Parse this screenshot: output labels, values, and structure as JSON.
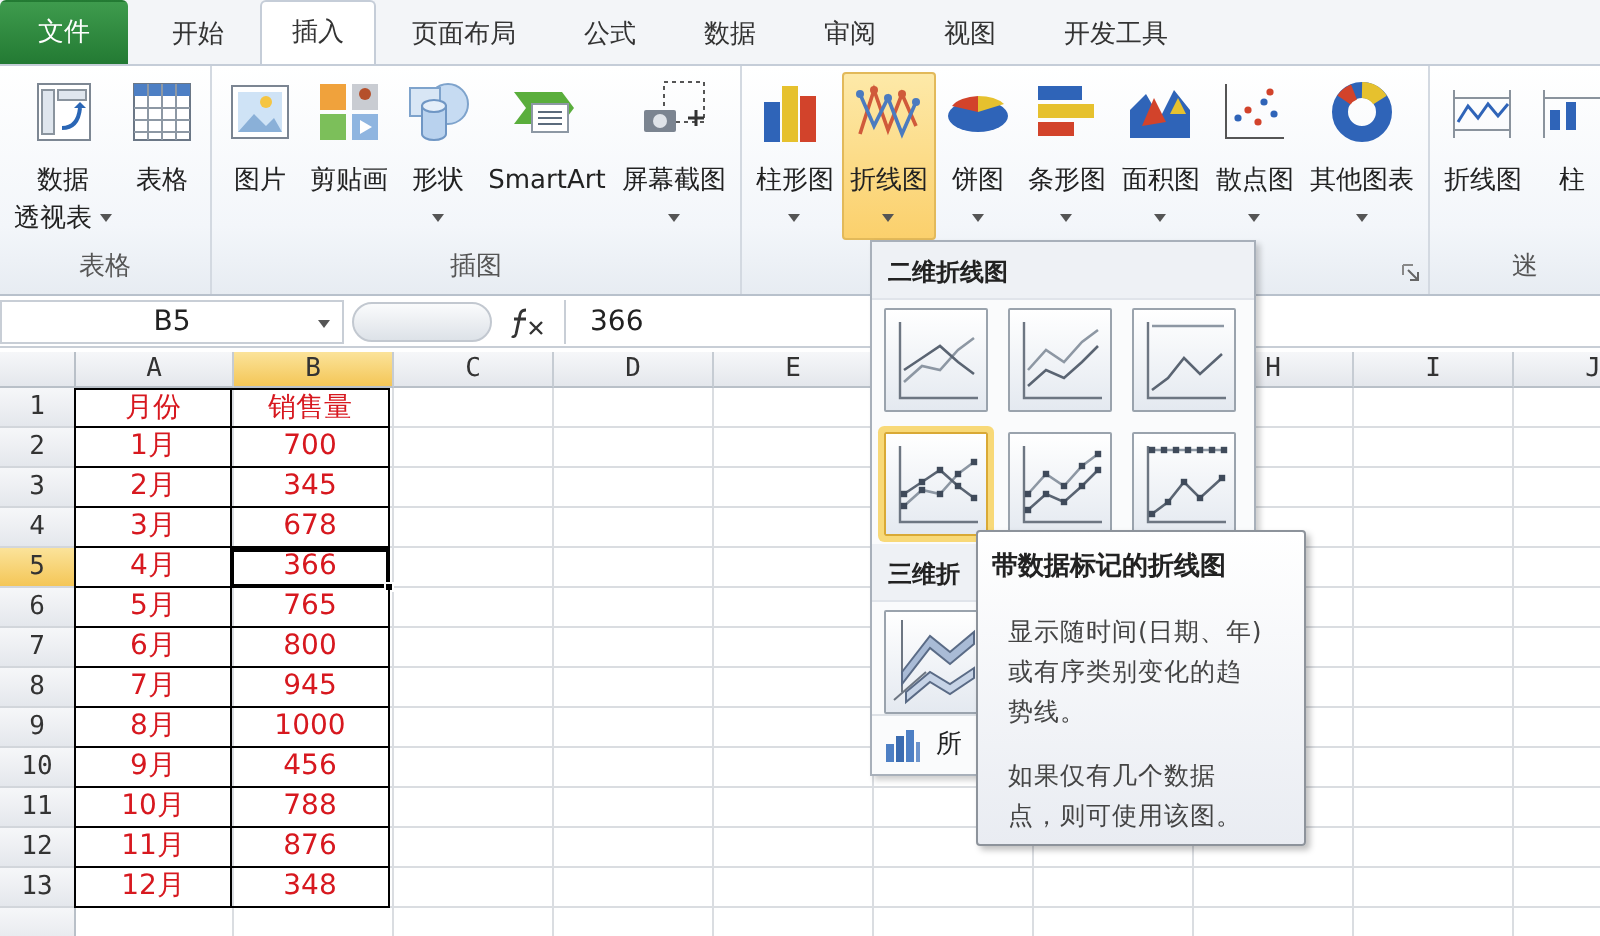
{
  "tabs": [
    {
      "label": "文件",
      "kind": "file",
      "selected": false
    },
    {
      "label": "开始",
      "kind": "tab",
      "selected": false
    },
    {
      "label": "插入",
      "kind": "tab",
      "selected": true
    },
    {
      "label": "页面布局",
      "kind": "tab",
      "selected": false
    },
    {
      "label": "公式",
      "kind": "tab",
      "selected": false
    },
    {
      "label": "数据",
      "kind": "tab",
      "selected": false
    },
    {
      "label": "审阅",
      "kind": "tab",
      "selected": false
    },
    {
      "label": "视图",
      "kind": "tab",
      "selected": false
    },
    {
      "label": "开发工具",
      "kind": "tab",
      "selected": false
    }
  ],
  "ribbon": {
    "groups": [
      {
        "label": "表格",
        "buttons": [
          {
            "kind": "pivot",
            "label": [
              "数据",
              "透视表"
            ],
            "dropdown": true,
            "selected": false
          },
          {
            "kind": "table",
            "label": [
              "表格"
            ],
            "dropdown": false,
            "selected": false
          }
        ]
      },
      {
        "label": "插图",
        "buttons": [
          {
            "kind": "picture",
            "label": [
              "图片"
            ],
            "dropdown": false,
            "selected": false
          },
          {
            "kind": "clipart",
            "label": [
              "剪贴画"
            ],
            "dropdown": false,
            "selected": false
          },
          {
            "kind": "shapes",
            "label": [
              "形状"
            ],
            "dropdown": true,
            "selected": false
          },
          {
            "kind": "smartart",
            "label": [
              "SmartArt"
            ],
            "dropdown": false,
            "selected": false
          },
          {
            "kind": "screenshot",
            "label": [
              "屏幕截图"
            ],
            "dropdown": true,
            "selected": false
          }
        ]
      },
      {
        "launcher": true,
        "buttons": [
          {
            "kind": "column",
            "label": [
              "柱形图"
            ],
            "dropdown": true,
            "selected": false
          },
          {
            "kind": "line",
            "label": [
              "折线图"
            ],
            "dropdown": true,
            "selected": true
          },
          {
            "kind": "pie",
            "label": [
              "饼图"
            ],
            "dropdown": true,
            "selected": false
          },
          {
            "kind": "bar",
            "label": [
              "条形图"
            ],
            "dropdown": true,
            "selected": false
          },
          {
            "kind": "area",
            "label": [
              "面积图"
            ],
            "dropdown": true,
            "selected": false
          },
          {
            "kind": "scatter",
            "label": [
              "散点图"
            ],
            "dropdown": true,
            "selected": false
          },
          {
            "kind": "other",
            "label": [
              "其他图表"
            ],
            "dropdown": true,
            "selected": false
          }
        ]
      },
      {
        "label": "迷",
        "buttons": [
          {
            "kind": "sparkline",
            "label": [
              "折线图"
            ],
            "dropdown": false,
            "selected": false
          },
          {
            "kind": "sparkcolumn",
            "label": [
              "柱"
            ],
            "dropdown": false,
            "selected": false
          }
        ]
      }
    ]
  },
  "formula_bar": {
    "name_box": "B5",
    "formula": "366"
  },
  "sheet": {
    "columns": [
      {
        "kind": "header",
        "label": "A",
        "selected": false
      },
      {
        "kind": "header",
        "label": "B",
        "selected": true
      },
      {
        "kind": "header",
        "label": "C",
        "selected": false
      },
      {
        "kind": "header",
        "label": "D",
        "selected": false
      },
      {
        "kind": "header",
        "label": "E",
        "selected": false
      },
      {
        "kind": "covered"
      },
      {
        "kind": "covered"
      },
      {
        "kind": "header",
        "label": "H",
        "selected": false
      },
      {
        "kind": "header",
        "label": "I",
        "selected": false
      },
      {
        "kind": "header",
        "label": "J",
        "selected": false
      }
    ],
    "rows": [
      {
        "number": "1",
        "selected": false,
        "cells": [
          "月份",
          "销售量"
        ]
      },
      {
        "number": "2",
        "selected": false,
        "cells": [
          "1月",
          "700"
        ]
      },
      {
        "number": "3",
        "selected": false,
        "cells": [
          "2月",
          "345"
        ]
      },
      {
        "number": "4",
        "selected": false,
        "cells": [
          "3月",
          "678"
        ]
      },
      {
        "number": "5",
        "selected": true,
        "cells": [
          "4月",
          "366"
        ]
      },
      {
        "number": "6",
        "selected": false,
        "cells": [
          "5月",
          "765"
        ]
      },
      {
        "number": "7",
        "selected": false,
        "cells": [
          "6月",
          "800"
        ]
      },
      {
        "number": "8",
        "selected": false,
        "cells": [
          "7月",
          "945"
        ]
      },
      {
        "number": "9",
        "selected": false,
        "cells": [
          "8月",
          "1000"
        ]
      },
      {
        "number": "10",
        "selected": false,
        "cells": [
          "9月",
          "456"
        ]
      },
      {
        "number": "11",
        "selected": false,
        "cells": [
          "10月",
          "788"
        ]
      },
      {
        "number": "12",
        "selected": false,
        "cells": [
          "11月",
          "876"
        ]
      },
      {
        "number": "13",
        "selected": false,
        "cells": [
          "12月",
          "348"
        ]
      }
    ]
  },
  "line_gallery": {
    "sections": [
      {
        "title": "二维折线图",
        "items": [
          {
            "kind": "line",
            "selected": false
          },
          {
            "kind": "stacked",
            "selected": false
          },
          {
            "kind": "percent",
            "selected": false
          },
          {
            "kind": "line-markers",
            "selected": true
          },
          {
            "kind": "stacked-markers",
            "selected": false
          },
          {
            "kind": "percent-markers",
            "selected": false
          }
        ]
      },
      {
        "title": "三维折",
        "items": [
          {
            "kind": "line-3d",
            "selected": false
          }
        ]
      }
    ],
    "footer": "所"
  },
  "tooltip": {
    "title": "带数据标记的折线图",
    "paragraphs": [
      "显示随时间(日期、年)或有序类别变化的趋势线。",
      "如果仅有几个数据点，则可使用该图。"
    ]
  }
}
